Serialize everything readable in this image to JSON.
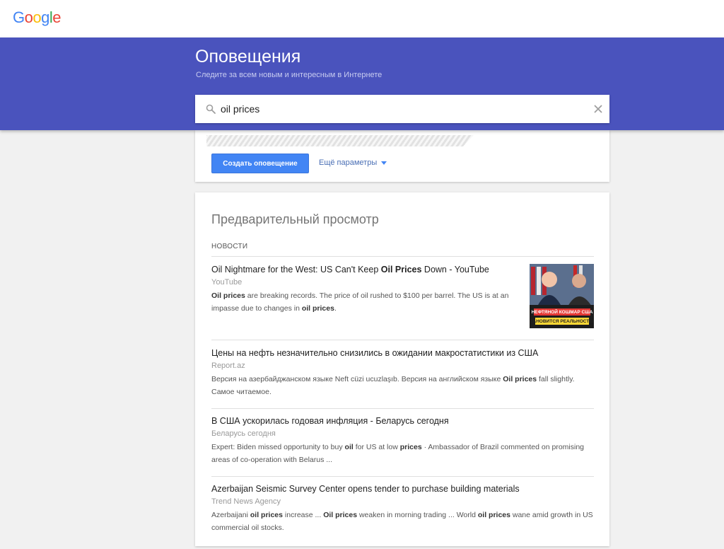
{
  "logo": {
    "text": "Google",
    "letters": [
      "G",
      "o",
      "o",
      "g",
      "l",
      "e"
    ],
    "colors": [
      "#4285f4",
      "#ea4335",
      "#fbbc05",
      "#4285f4",
      "#34a853",
      "#ea4335"
    ]
  },
  "hero": {
    "title": "Оповещения",
    "subtitle": "Следите за всем новым и интересным в Интернете",
    "background": "#4a53bd"
  },
  "search": {
    "value": "oil prices",
    "icon": "search-icon",
    "clear_icon": "close-icon"
  },
  "options": {
    "create_label": "Создать оповещение",
    "more_label": "Ещё параметры",
    "accent": "#4285f4"
  },
  "preview": {
    "title": "Предварительный просмотр",
    "section_label": "НОВОСТИ",
    "items": [
      {
        "title_parts": [
          {
            "text": "Oil Nightmare for the West: US Can't Keep ",
            "bold": false
          },
          {
            "text": "Oil Prices",
            "bold": true
          },
          {
            "text": " Down - YouTube",
            "bold": false
          }
        ],
        "source": "YouTube",
        "snippet_parts": [
          {
            "text": "Oil prices",
            "bold": true
          },
          {
            "text": " are breaking records. The price of oil rushed to $100 per barrel. The US is at an impasse due to changes in ",
            "bold": false
          },
          {
            "text": "oil prices",
            "bold": true
          },
          {
            "text": ".",
            "bold": false
          }
        ],
        "thumbnail_caption": "НЕФТЯНОЙ КОШМАР США СТАНОВИТСЯ РЕАЛЬНОСТЬЮ"
      },
      {
        "title_parts": [
          {
            "text": "Цены на нефть незначительно снизились в ожидании макростатистики из США",
            "bold": false
          }
        ],
        "source": "Report.az",
        "snippet_parts": [
          {
            "text": "Версия на азербайджанском языке Neft cüzi ucuzlaşıb. Версия на английском языке ",
            "bold": false
          },
          {
            "text": "Oil prices",
            "bold": true
          },
          {
            "text": " fall slightly. Самое читаемое.",
            "bold": false
          }
        ]
      },
      {
        "title_parts": [
          {
            "text": "В США ускорилась годовая инфляция - Беларусь сегодня",
            "bold": false
          }
        ],
        "source": "Беларусь сегодня",
        "snippet_parts": [
          {
            "text": "Expert: Biden missed opportunity to buy ",
            "bold": false
          },
          {
            "text": "oil",
            "bold": true
          },
          {
            "text": " for US at low ",
            "bold": false
          },
          {
            "text": "prices",
            "bold": true
          },
          {
            "text": " · Ambassador of Brazil commented on promising areas of co-operation with Belarus ...",
            "bold": false
          }
        ]
      },
      {
        "title_parts": [
          {
            "text": "Azerbaijan Seismic Survey Center opens tender to purchase building materials",
            "bold": false
          }
        ],
        "source": "Trend News Agency",
        "snippet_parts": [
          {
            "text": "Azerbaijani ",
            "bold": false
          },
          {
            "text": "oil prices",
            "bold": true
          },
          {
            "text": " increase ... ",
            "bold": false
          },
          {
            "text": "Oil prices",
            "bold": true
          },
          {
            "text": " weaken in morning trading ... World ",
            "bold": false
          },
          {
            "text": "oil prices",
            "bold": true
          },
          {
            "text": " wane amid growth in US commercial oil stocks.",
            "bold": false
          }
        ]
      }
    ]
  }
}
